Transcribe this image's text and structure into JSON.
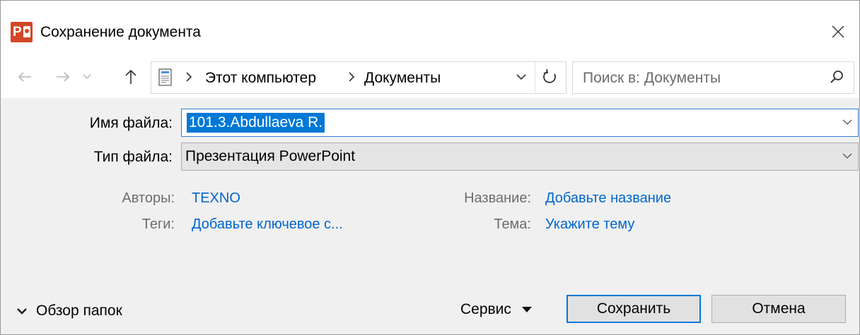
{
  "window": {
    "title": "Сохранение документа",
    "app_icon": "powerpoint-icon",
    "close_icon": "close-icon"
  },
  "nav": {
    "back_icon": "arrow-left-icon",
    "forward_icon": "arrow-right-icon",
    "recent_icon": "chevron-down-icon",
    "up_icon": "arrow-up-icon",
    "breadcrumb": [
      "Этот компьютер",
      "Документы"
    ],
    "refresh_icon": "refresh-icon"
  },
  "search": {
    "placeholder": "Поиск в: Документы",
    "icon": "search-icon"
  },
  "form": {
    "filename_label": "Имя файла:",
    "filename_value": "101.3.Abdullaeva R.",
    "filetype_label": "Тип файла:",
    "filetype_value": "Презентация PowerPoint"
  },
  "metadata": {
    "authors_label": "Авторы:",
    "authors_value": "TEXNO",
    "tags_label": "Теги:",
    "tags_value": "Добавьте ключевое с...",
    "title_label": "Название:",
    "title_value": "Добавьте название",
    "subject_label": "Тема:",
    "subject_value": "Укажите тему"
  },
  "footer": {
    "browse_label": "Обзор папок",
    "service_label": "Сервис",
    "save_label": "Сохранить",
    "cancel_label": "Отмена"
  },
  "colors": {
    "accent": "#0078d7",
    "link": "#0066cc",
    "app_icon": "#d24726",
    "dialog_bg": "#f0f0f0"
  }
}
